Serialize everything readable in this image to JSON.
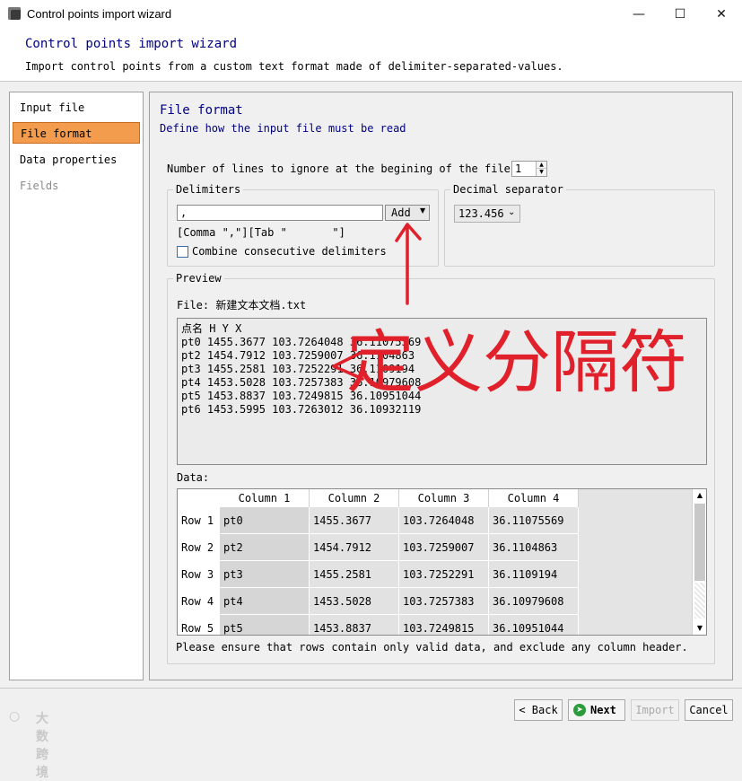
{
  "window": {
    "title": "Control points import wizard"
  },
  "header": {
    "title": "Control points import wizard",
    "description": "Import control points from a custom text format made of delimiter-separated-values."
  },
  "sidebar": {
    "items": [
      {
        "label": "Input file",
        "state": "normal"
      },
      {
        "label": "File format",
        "state": "active"
      },
      {
        "label": "Data properties",
        "state": "normal"
      },
      {
        "label": "Fields",
        "state": "disabled"
      }
    ]
  },
  "page": {
    "title": "File format",
    "subtitle": "Define how the input file must be read"
  },
  "ignore_lines": {
    "label": "Number of lines to ignore at the begining of the file:",
    "value": "1"
  },
  "delimiters": {
    "group_label": "Delimiters",
    "input_value": ",",
    "add_label": "Add",
    "list_text": "[Comma \",\"][Tab \"\t\"]",
    "combine_label": "Combine consecutive delimiters"
  },
  "decimal": {
    "group_label": "Decimal separator",
    "value": "123.456"
  },
  "preview": {
    "group_label": "Preview",
    "file_line": "File: 新建文本文档.txt",
    "lines": "点名 H Y X\npt0 1455.3677 103.7264048 36.11075569\npt2 1454.7912 103.7259007 36.1104863\npt3 1455.2581 103.7252291 36.1109194\npt4 1453.5028 103.7257383 36.10979608\npt5 1453.8837 103.7249815 36.10951044\npt6 1453.5995 103.7263012 36.10932119"
  },
  "data_table": {
    "label": "Data:",
    "columns": [
      "Column 1",
      "Column 2",
      "Column 3",
      "Column 4"
    ],
    "rows": [
      {
        "label": "Row 1",
        "cells": [
          "pt0",
          "1455.3677",
          "103.7264048",
          "36.11075569"
        ]
      },
      {
        "label": "Row 2",
        "cells": [
          "pt2",
          "1454.7912",
          "103.7259007",
          "36.1104863"
        ]
      },
      {
        "label": "Row 3",
        "cells": [
          "pt3",
          "1455.2581",
          "103.7252291",
          "36.1109194"
        ]
      },
      {
        "label": "Row 4",
        "cells": [
          "pt4",
          "1453.5028",
          "103.7257383",
          "36.10979608"
        ]
      },
      {
        "label": "Row 5",
        "cells": [
          "pt5",
          "1453.8837",
          "103.7249815",
          "36.10951044"
        ]
      }
    ]
  },
  "note": "Please ensure that rows contain only valid data, and exclude any column header.",
  "annotation": {
    "text": "定义分隔符",
    "color": "#e0202a"
  },
  "footer": {
    "back": "Back",
    "next": "Next",
    "import": "Import",
    "cancel": "Cancel"
  },
  "watermark": "大数跨境",
  "colors": {
    "accent": "#f39c4e",
    "title_blue": "#000080"
  }
}
